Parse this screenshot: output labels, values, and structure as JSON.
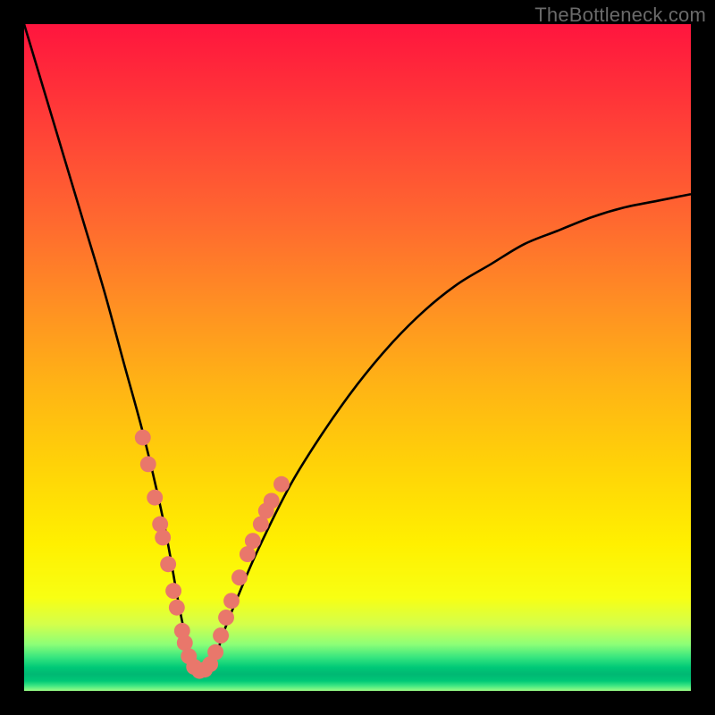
{
  "watermark": "TheBottleneck.com",
  "chart_data": {
    "type": "line",
    "title": "",
    "xlabel": "",
    "ylabel": "",
    "xlim": [
      0,
      100
    ],
    "ylim": [
      0,
      100
    ],
    "grid": false,
    "note": "Axes are unlabeled; values below are pixel-estimated percentages of plot area. Curve is a V-shaped bottleneck curve with minimum near x≈26.",
    "series": [
      {
        "name": "bottleneck-curve",
        "x": [
          0,
          3,
          6,
          9,
          12,
          15,
          18,
          21,
          23,
          24,
          25,
          26,
          27,
          28,
          29,
          30,
          32,
          35,
          40,
          45,
          50,
          55,
          60,
          65,
          70,
          75,
          80,
          85,
          90,
          95,
          100
        ],
        "y": [
          100,
          90,
          80,
          70,
          60,
          49,
          38,
          25,
          14,
          9,
          5,
          3,
          3,
          4,
          6,
          9,
          14,
          21,
          31,
          39,
          46,
          52,
          57,
          61,
          64,
          67,
          69,
          71,
          72.5,
          73.5,
          74.5
        ],
        "color": "#000000"
      }
    ],
    "markers": {
      "name": "highlight-dots",
      "color": "#e9776b",
      "radius_pct": 1.2,
      "points": [
        {
          "x": 17.8,
          "y": 38
        },
        {
          "x": 18.6,
          "y": 34
        },
        {
          "x": 19.6,
          "y": 29
        },
        {
          "x": 20.4,
          "y": 25
        },
        {
          "x": 20.8,
          "y": 23
        },
        {
          "x": 21.6,
          "y": 19
        },
        {
          "x": 22.4,
          "y": 15
        },
        {
          "x": 22.9,
          "y": 12.5
        },
        {
          "x": 23.7,
          "y": 9
        },
        {
          "x": 24.1,
          "y": 7.2
        },
        {
          "x": 24.7,
          "y": 5.2
        },
        {
          "x": 25.5,
          "y": 3.6
        },
        {
          "x": 26.3,
          "y": 3.0
        },
        {
          "x": 27.1,
          "y": 3.2
        },
        {
          "x": 27.9,
          "y": 4.0
        },
        {
          "x": 28.7,
          "y": 5.8
        },
        {
          "x": 29.5,
          "y": 8.3
        },
        {
          "x": 30.3,
          "y": 11
        },
        {
          "x": 31.1,
          "y": 13.5
        },
        {
          "x": 32.3,
          "y": 17
        },
        {
          "x": 33.5,
          "y": 20.5
        },
        {
          "x": 34.3,
          "y": 22.5
        },
        {
          "x": 35.5,
          "y": 25
        },
        {
          "x": 36.3,
          "y": 27
        },
        {
          "x": 37.1,
          "y": 28.5
        },
        {
          "x": 38.6,
          "y": 31
        }
      ]
    }
  }
}
